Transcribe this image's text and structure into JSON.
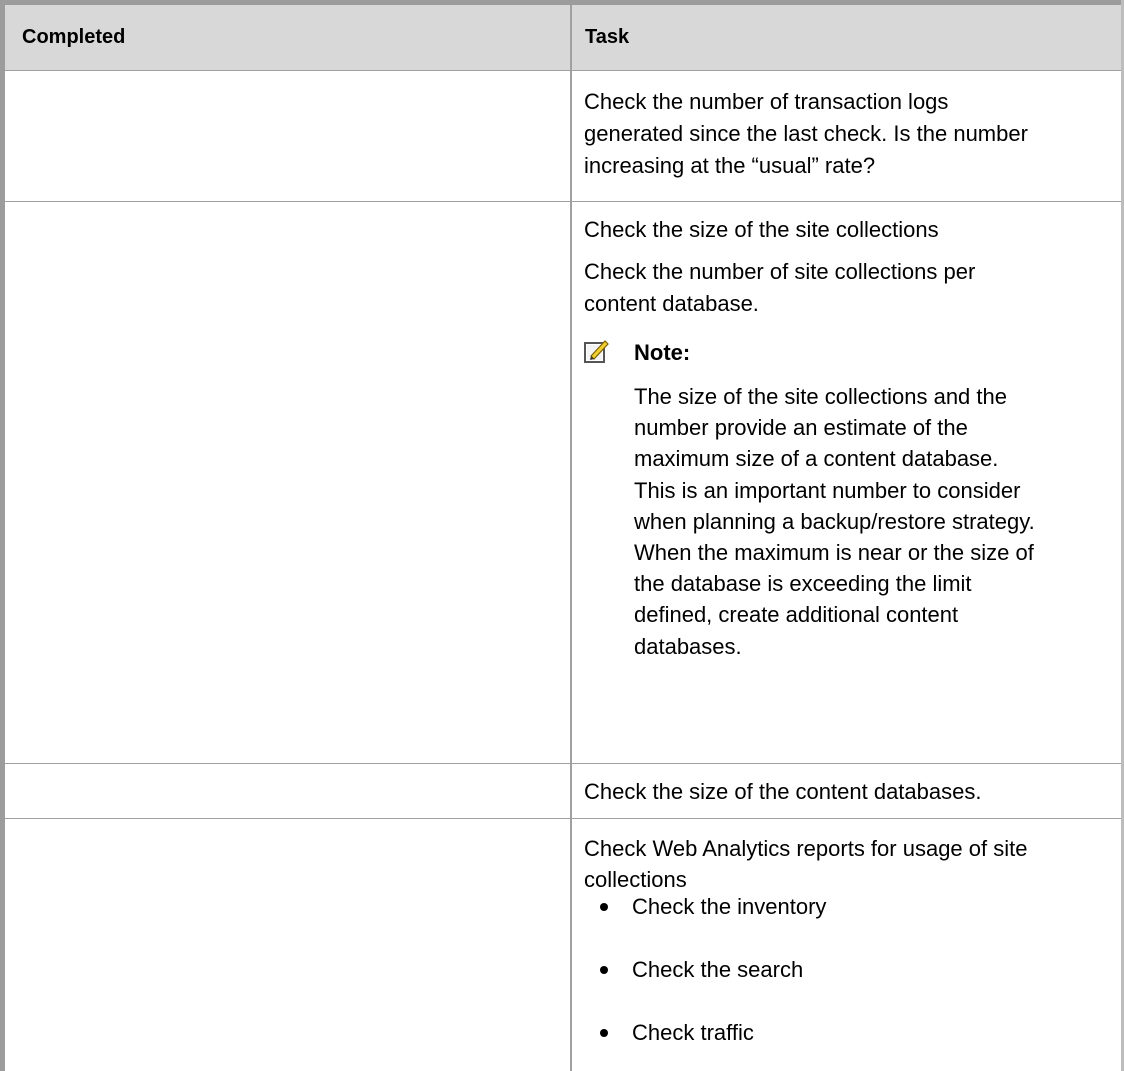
{
  "table": {
    "headers": {
      "completed": "Completed",
      "task": "Task"
    },
    "rows": [
      {
        "completed": "",
        "task_lines": [
          "Check the number of transaction logs",
          "generated since the last check. Is the number",
          "increasing at the “usual” rate?"
        ]
      },
      {
        "completed": "",
        "task_lines": [
          "Check the size of the site collections",
          "Check the number of site collections per",
          "content database."
        ],
        "note": {
          "icon": "note-pencil-icon",
          "label": "Note:",
          "lines": [
            "The size of the site collections and the",
            "number provide an estimate of the",
            "maximum size of a content database.",
            "This is an important number to consider",
            "when planning a backup/restore strategy.",
            "When the maximum is near or the size of",
            "the database is exceeding the limit",
            "defined, create additional content",
            "databases."
          ]
        }
      },
      {
        "completed": "",
        "task_lines": [
          "Check the size of the content databases."
        ]
      },
      {
        "completed": "",
        "task_lines": [
          "Check Web Analytics reports for usage of site",
          "collections"
        ],
        "bullets": [
          "Check the inventory",
          "Check the search",
          "Check traffic"
        ]
      }
    ]
  },
  "colors": {
    "header_bg": "#d8d8d8",
    "border": "#9c9c9c",
    "note_icon_yellow": "#f0d030"
  }
}
